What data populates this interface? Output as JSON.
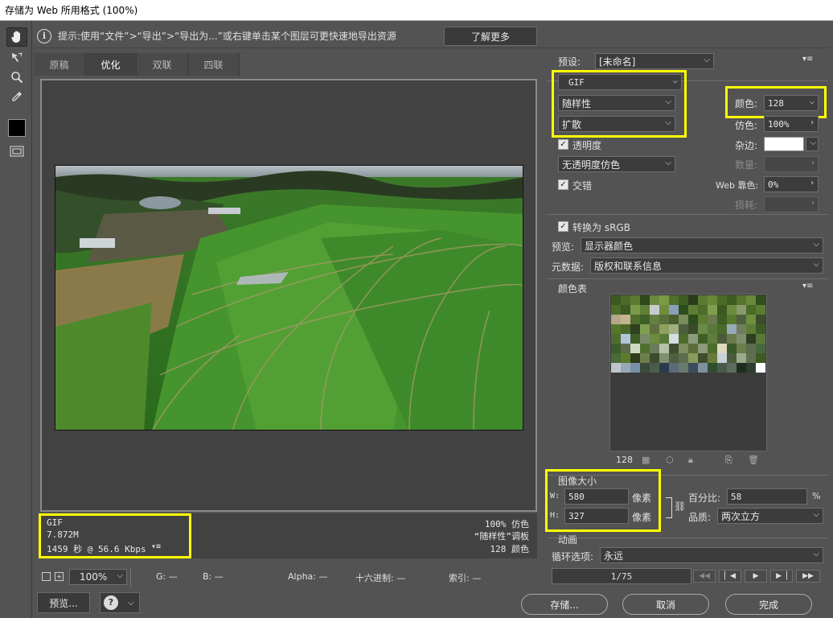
{
  "window": {
    "title": "存储为 Web 所用格式 (100%)"
  },
  "hint": {
    "text": "提示:使用“文件”>“导出”>“导出为...”或右键单击某个图层可更快速地导出资源",
    "learn_more": "了解更多"
  },
  "tabs": [
    "原稿",
    "优化",
    "双联",
    "四联"
  ],
  "status": {
    "format": "GIF",
    "size": "7.872M",
    "time": "1459 秒 @ 56.6 Kbps",
    "dither": "100% 仿色",
    "palette": "“随样性”调板",
    "colors": "128 颜色"
  },
  "bottom": {
    "zoom": "100%",
    "g_label": "G: —",
    "b_label": "B: —",
    "alpha_label": "Alpha: —",
    "hex_label": "十六进制: —",
    "index_label": "索引: —",
    "preview_button": "预览...",
    "save_button": "存储...",
    "cancel_button": "取消",
    "done_button": "完成"
  },
  "settings": {
    "preset_label": "预设:",
    "preset_value": "[未命名]",
    "format_value": "GIF",
    "reduction_value": "随样性",
    "dither_algo_value": "扩散",
    "colors_label": "颜色:",
    "colors_value": "128",
    "dither_label": "仿色:",
    "dither_value": "100%",
    "transparency_label": "透明度",
    "matte_label": "杂边:",
    "transparency_dither_value": "无透明度仿色",
    "amount_label": "数量:",
    "interlaced_label": "交错",
    "web_snap_label": "Web 靠色:",
    "web_snap_value": "0%",
    "lossy_label": "损耗:",
    "convert_srgb_label": "转换为 sRGB",
    "preview_label": "预览:",
    "preview_value": "显示器颜色",
    "metadata_label": "元数据:",
    "metadata_value": "版权和联系信息"
  },
  "color_table": {
    "title": "颜色表",
    "count": "128",
    "colors": [
      "#3a5a22",
      "#4a6a2a",
      "#5c7a32",
      "#2e4a1c",
      "#6b8a3c",
      "#7c9a46",
      "#4f6f2d",
      "#3d5d25",
      "#2a3d1a",
      "#5a7a30",
      "#688838",
      "#4b6b28",
      "#3c5c24",
      "#567630",
      "#6a8a3a",
      "#2f4f1f",
      "#4d6d2b",
      "#3b5b23",
      "#7a9a4a",
      "#5f7f35",
      "#c8ccd0",
      "#6e8e3e",
      "#8aa0b8",
      "#2c4c1c",
      "#5e7e34",
      "#4c6c2a",
      "#7e9e4e",
      "#3a5a20",
      "#6c8c3c",
      "#8a9a6a",
      "#4a6a28",
      "#5b7b31",
      "#b8a88a",
      "#c4b490",
      "#4e6e2c",
      "#3f5f27",
      "#667f40",
      "#5a6f3a",
      "#4a5f30",
      "#7b8b5b",
      "#2d4d1d",
      "#5c7c32",
      "#6a7a4a",
      "#3e5e26",
      "#597931",
      "#4f5f3f",
      "#6f8f3f",
      "#3c4c2c",
      "#56762e",
      "#4a6a2a",
      "#2f3f1f",
      "#7f9f4f",
      "#5f6f3f",
      "#8fa05f",
      "#a0b080",
      "#4d5d3d",
      "#3a4a2a",
      "#6a8a4a",
      "#58783a",
      "#4b6b2b",
      "#9aaab8",
      "#6e7e5e",
      "#5d7d35",
      "#3b5b23",
      "#4e6e2e",
      "#b0c4dc",
      "#3d5d25",
      "#7a8a6a",
      "#6c8c3c",
      "#5a7a3a",
      "#d4dce4",
      "#4c6c2c",
      "#8c9c7c",
      "#3f5f27",
      "#5e7e3e",
      "#4a5a3a",
      "#6b7b4b",
      "#7d8d6d",
      "#2e3e1e",
      "#59793a",
      "#3c5c2c",
      "#5a6a4a",
      "#cfd8c0",
      "#4f6f2f",
      "#6a7a5a",
      "#b8c0a8",
      "#3e4e2e",
      "#7e8e5e",
      "#5b6b3b",
      "#8a9a7a",
      "#4d6d2d",
      "#e0d8c0",
      "#3a5a2a",
      "#6c7c4c",
      "#5c6c4c",
      "#47673f",
      "#4a6a3a",
      "#5b7b2b",
      "#2c3c1c",
      "#6d7d4d",
      "#3b4b2b",
      "#7f8f6f",
      "#4e5e3e",
      "#5d6d4d",
      "#8b9b5b",
      "#3d4d2d",
      "#6a7a3a",
      "#c8d0d8",
      "#4b5b3b",
      "#9aaa8a",
      "#5f6f4f",
      "#3c5a20",
      "#c0c4cc",
      "#98a8b8",
      "#7890a8",
      "#3a4a3a",
      "#4c5c4c",
      "#2a3a4a",
      "#5a6a7a",
      "#6a7a6a",
      "#3c4c5c",
      "#8090a0",
      "#2e4e2e",
      "#4a5a4a",
      "#5c6c5c",
      "#1e2e1e",
      "#2f3f2f",
      "#ffffff"
    ]
  },
  "image_size": {
    "title": "图像大小",
    "w_label": "W:",
    "w_value": "580",
    "h_label": "H:",
    "h_value": "327",
    "px_unit": "像素",
    "percent_label": "百分比:",
    "percent_value": "58",
    "percent_unit": "%",
    "quality_label": "品质:",
    "quality_value": "两次立方"
  },
  "animation": {
    "title": "动画",
    "loop_label": "循环选项:",
    "loop_value": "永远",
    "frame_counter": "1/75"
  }
}
